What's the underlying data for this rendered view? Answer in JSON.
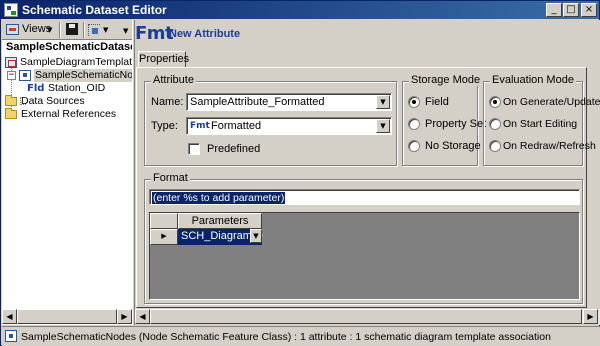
{
  "window": {
    "title": "Schematic Dataset Editor",
    "minimize_glyph": "_",
    "maximize_glyph": "□",
    "close_glyph": "×"
  },
  "toolbar": {
    "views_label": "Views",
    "dropdown_caret": "▼"
  },
  "tree": {
    "dataset_name": "SampleSchematicDataset",
    "items": [
      {
        "label": "SampleDiagramTemplate"
      },
      {
        "label": "SampleSchematicNodes",
        "expander": "−"
      },
      {
        "label": "Station_OID",
        "prefix": "Fld"
      },
      {
        "label": "Data Sources"
      },
      {
        "label": "External References"
      }
    ]
  },
  "header": {
    "type_badge": "Fmt",
    "title": "New Attribute"
  },
  "tabs": [
    {
      "label": "Properties"
    }
  ],
  "attribute_group": {
    "title": "Attribute",
    "name_label": "Name:",
    "name_value": "SampleAttribute_Formatted",
    "type_label": "Type:",
    "type_badge": "Fmt",
    "type_value": "Formatted",
    "predefined_label": "Predefined",
    "predefined_checked": false
  },
  "storage_mode": {
    "title": "Storage Mode",
    "options": [
      {
        "label": "Field",
        "selected": true
      },
      {
        "label": "Property Set",
        "selected": false
      },
      {
        "label": "No Storage",
        "selected": false
      }
    ]
  },
  "evaluation_mode": {
    "title": "Evaluation Mode",
    "options": [
      {
        "label": "On Generate/Update",
        "selected": true
      },
      {
        "label": "On Start Editing",
        "selected": false
      },
      {
        "label": "On Redraw/Refresh",
        "selected": false
      }
    ]
  },
  "format_group": {
    "title": "Format",
    "input_value": "(enter %s to add parameter)",
    "grid": {
      "column_header": "Parameters",
      "row_marker": "▶",
      "rows": [
        {
          "value": "SCH_DiagramID"
        }
      ]
    }
  },
  "scroll": {
    "left_arrow": "◀",
    "right_arrow": "▶"
  },
  "status": {
    "text": "SampleSchematicNodes (Node Schematic Feature Class) : 1 attribute : 1 schematic diagram template association"
  },
  "colors": {
    "title_bar": "#0a246a",
    "accent": "#1c3f94",
    "selection": "#0a246a",
    "face": "#d4d0c8"
  }
}
